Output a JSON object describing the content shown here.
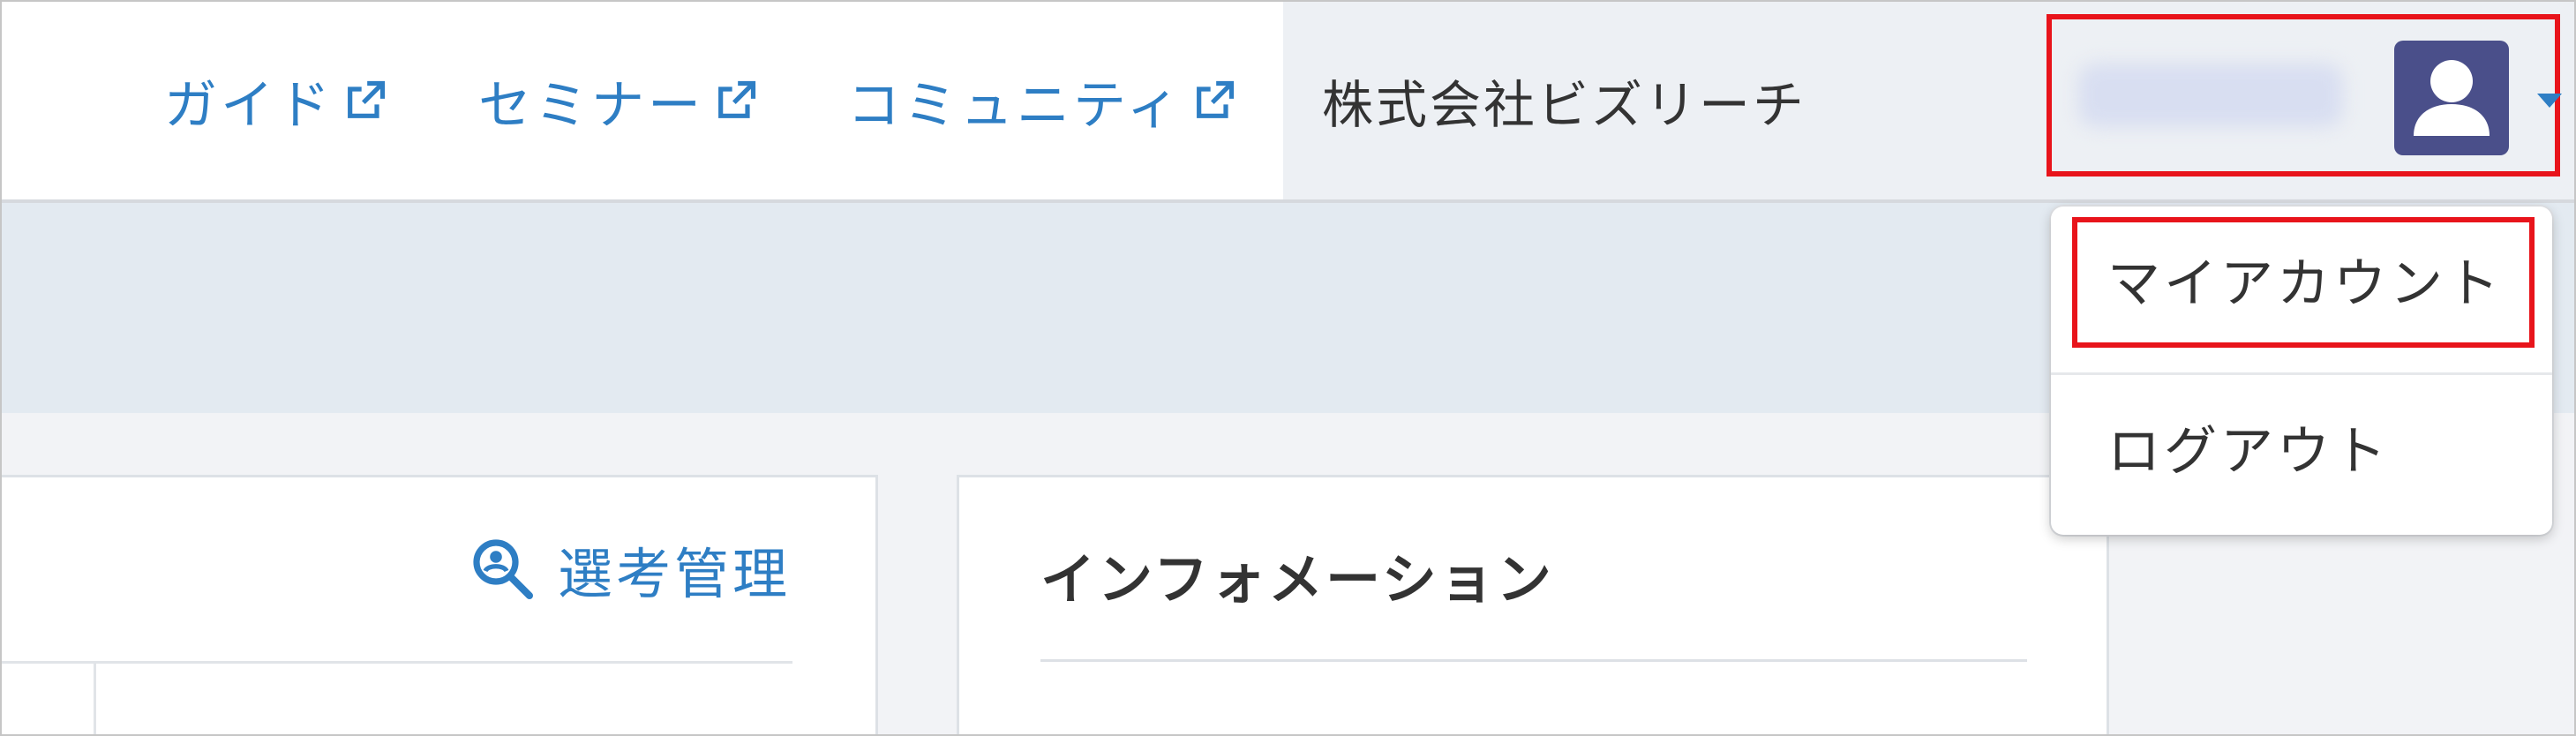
{
  "nav": {
    "links": [
      {
        "label": "ガイド",
        "icon": "external-link-icon"
      },
      {
        "label": "セミナー",
        "icon": "external-link-icon"
      },
      {
        "label": "コミュニティ",
        "icon": "external-link-icon"
      }
    ],
    "company_name": "株式会社ビズリーチ"
  },
  "user": {
    "avatar_icon": "user-avatar-icon",
    "caret_icon": "caret-down-icon"
  },
  "menu": {
    "items": [
      {
        "label": "マイアカウント"
      },
      {
        "label": "ログアウト"
      }
    ]
  },
  "main": {
    "selection_link": {
      "label": "選考管理",
      "icon": "search-magnifier-icon"
    },
    "info_panel": {
      "title": "インフォメーション"
    }
  },
  "colors": {
    "link": "#2e7ec4",
    "highlight": "#e8141b",
    "avatar_bg": "#4a4f8a",
    "subband": "#e3eaf1",
    "company_bg": "#edf0f4"
  }
}
